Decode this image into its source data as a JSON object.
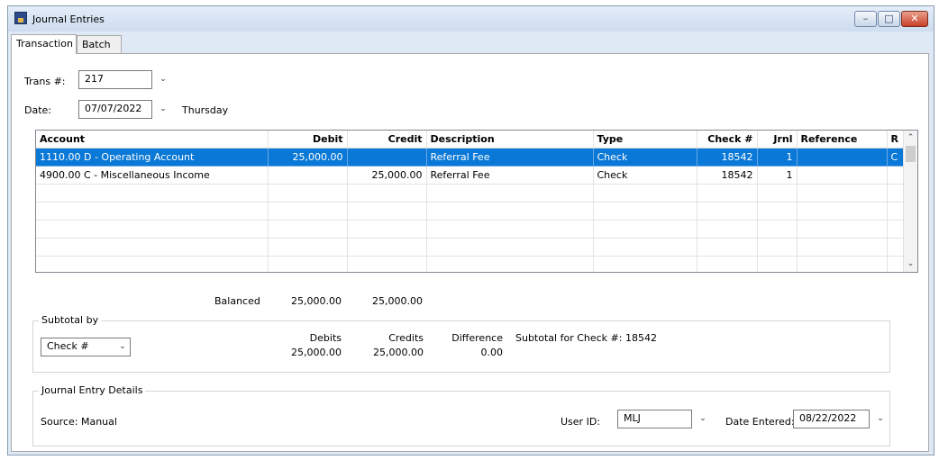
{
  "window": {
    "title": "Journal Entries",
    "minimize": "–",
    "maximize": "□",
    "close": "✕"
  },
  "tabs": [
    {
      "label": "Transaction",
      "active": true
    },
    {
      "label": "Batch",
      "active": false
    }
  ],
  "header": {
    "trans_label": "Trans #:",
    "trans_value": "217",
    "date_label": "Date:",
    "date_value": "07/07/2022",
    "day_of_week": "Thursday"
  },
  "grid": {
    "columns": [
      "Account",
      "Debit",
      "Credit",
      "Description",
      "Type",
      "Check #",
      "Jrnl",
      "Reference",
      "R"
    ],
    "rows": [
      {
        "account": "1110.00 D - Operating Account",
        "debit": "25,000.00",
        "credit": "",
        "description": "Referral Fee",
        "type": "Check",
        "check": "18542",
        "jrnl": "1",
        "reference": "",
        "r": "C",
        "selected": true
      },
      {
        "account": "4900.00 C - Miscellaneous Income",
        "debit": "",
        "credit": "25,000.00",
        "description": "Referral Fee",
        "type": "Check",
        "check": "18542",
        "jrnl": "1",
        "reference": "",
        "r": "",
        "selected": false
      }
    ]
  },
  "totals": {
    "status": "Balanced",
    "debit": "25,000.00",
    "credit": "25,000.00"
  },
  "subtotal": {
    "group_title": "Subtotal by",
    "select_value": "Check #",
    "debits_label": "Debits",
    "credits_label": "Credits",
    "difference_label": "Difference",
    "debits_value": "25,000.00",
    "credits_value": "25,000.00",
    "difference_value": "0.00",
    "subtotal_text": "Subtotal for Check #: 18542"
  },
  "details": {
    "group_title": "Journal Entry Details",
    "source": "Source: Manual",
    "user_id_label": "User ID:",
    "user_id_value": "MLJ",
    "date_entered_label": "Date Entered:",
    "date_entered_value": "08/22/2022"
  },
  "colors": {
    "selection": "#0a78d7",
    "frame": "#dfe9f5",
    "close_button": "#c8402a"
  }
}
